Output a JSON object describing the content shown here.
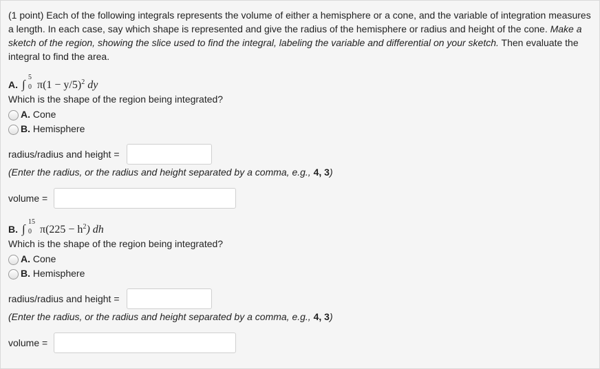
{
  "intro": {
    "text_plain": "(1 point) Each of the following integrals represents the volume of either a hemisphere or a cone, and the variable of integration measures a length. In each case, say which shape is represented and give the radius of the hemisphere or radius and height of the cone. ",
    "text_emph": "Make a sketch of the region, showing the slice used to find the integral, labeling the variable and differential on your sketch.",
    "text_end": " Then evaluate the integral to find the area."
  },
  "questions": [
    {
      "letter": "A.",
      "upper": "5",
      "lower": "0",
      "integrand_a": "π(1 − y/5)",
      "power": "2",
      "integrand_b": " dy",
      "question": "Which is the shape of the region being integrated?",
      "options": [
        {
          "letter": "A.",
          "label": "Cone"
        },
        {
          "letter": "B.",
          "label": "Hemisphere"
        }
      ],
      "radius_label": "radius/radius and height =",
      "radius_value": "",
      "note_text": "(Enter the radius, or the radius and height separated by a comma, e.g., ",
      "note_example": "4, 3",
      "note_close": ")",
      "volume_label": "volume =",
      "volume_value": ""
    },
    {
      "letter": "B.",
      "upper": "15",
      "lower": "0",
      "integrand_a": "π(225 − h",
      "power": "2",
      "integrand_b": ") dh",
      "question": "Which is the shape of the region being integrated?",
      "options": [
        {
          "letter": "A.",
          "label": "Cone"
        },
        {
          "letter": "B.",
          "label": "Hemisphere"
        }
      ],
      "radius_label": "radius/radius and height =",
      "radius_value": "",
      "note_text": "(Enter the radius, or the radius and height separated by a comma, e.g., ",
      "note_example": "4, 3",
      "note_close": ")",
      "volume_label": "volume =",
      "volume_value": ""
    }
  ]
}
